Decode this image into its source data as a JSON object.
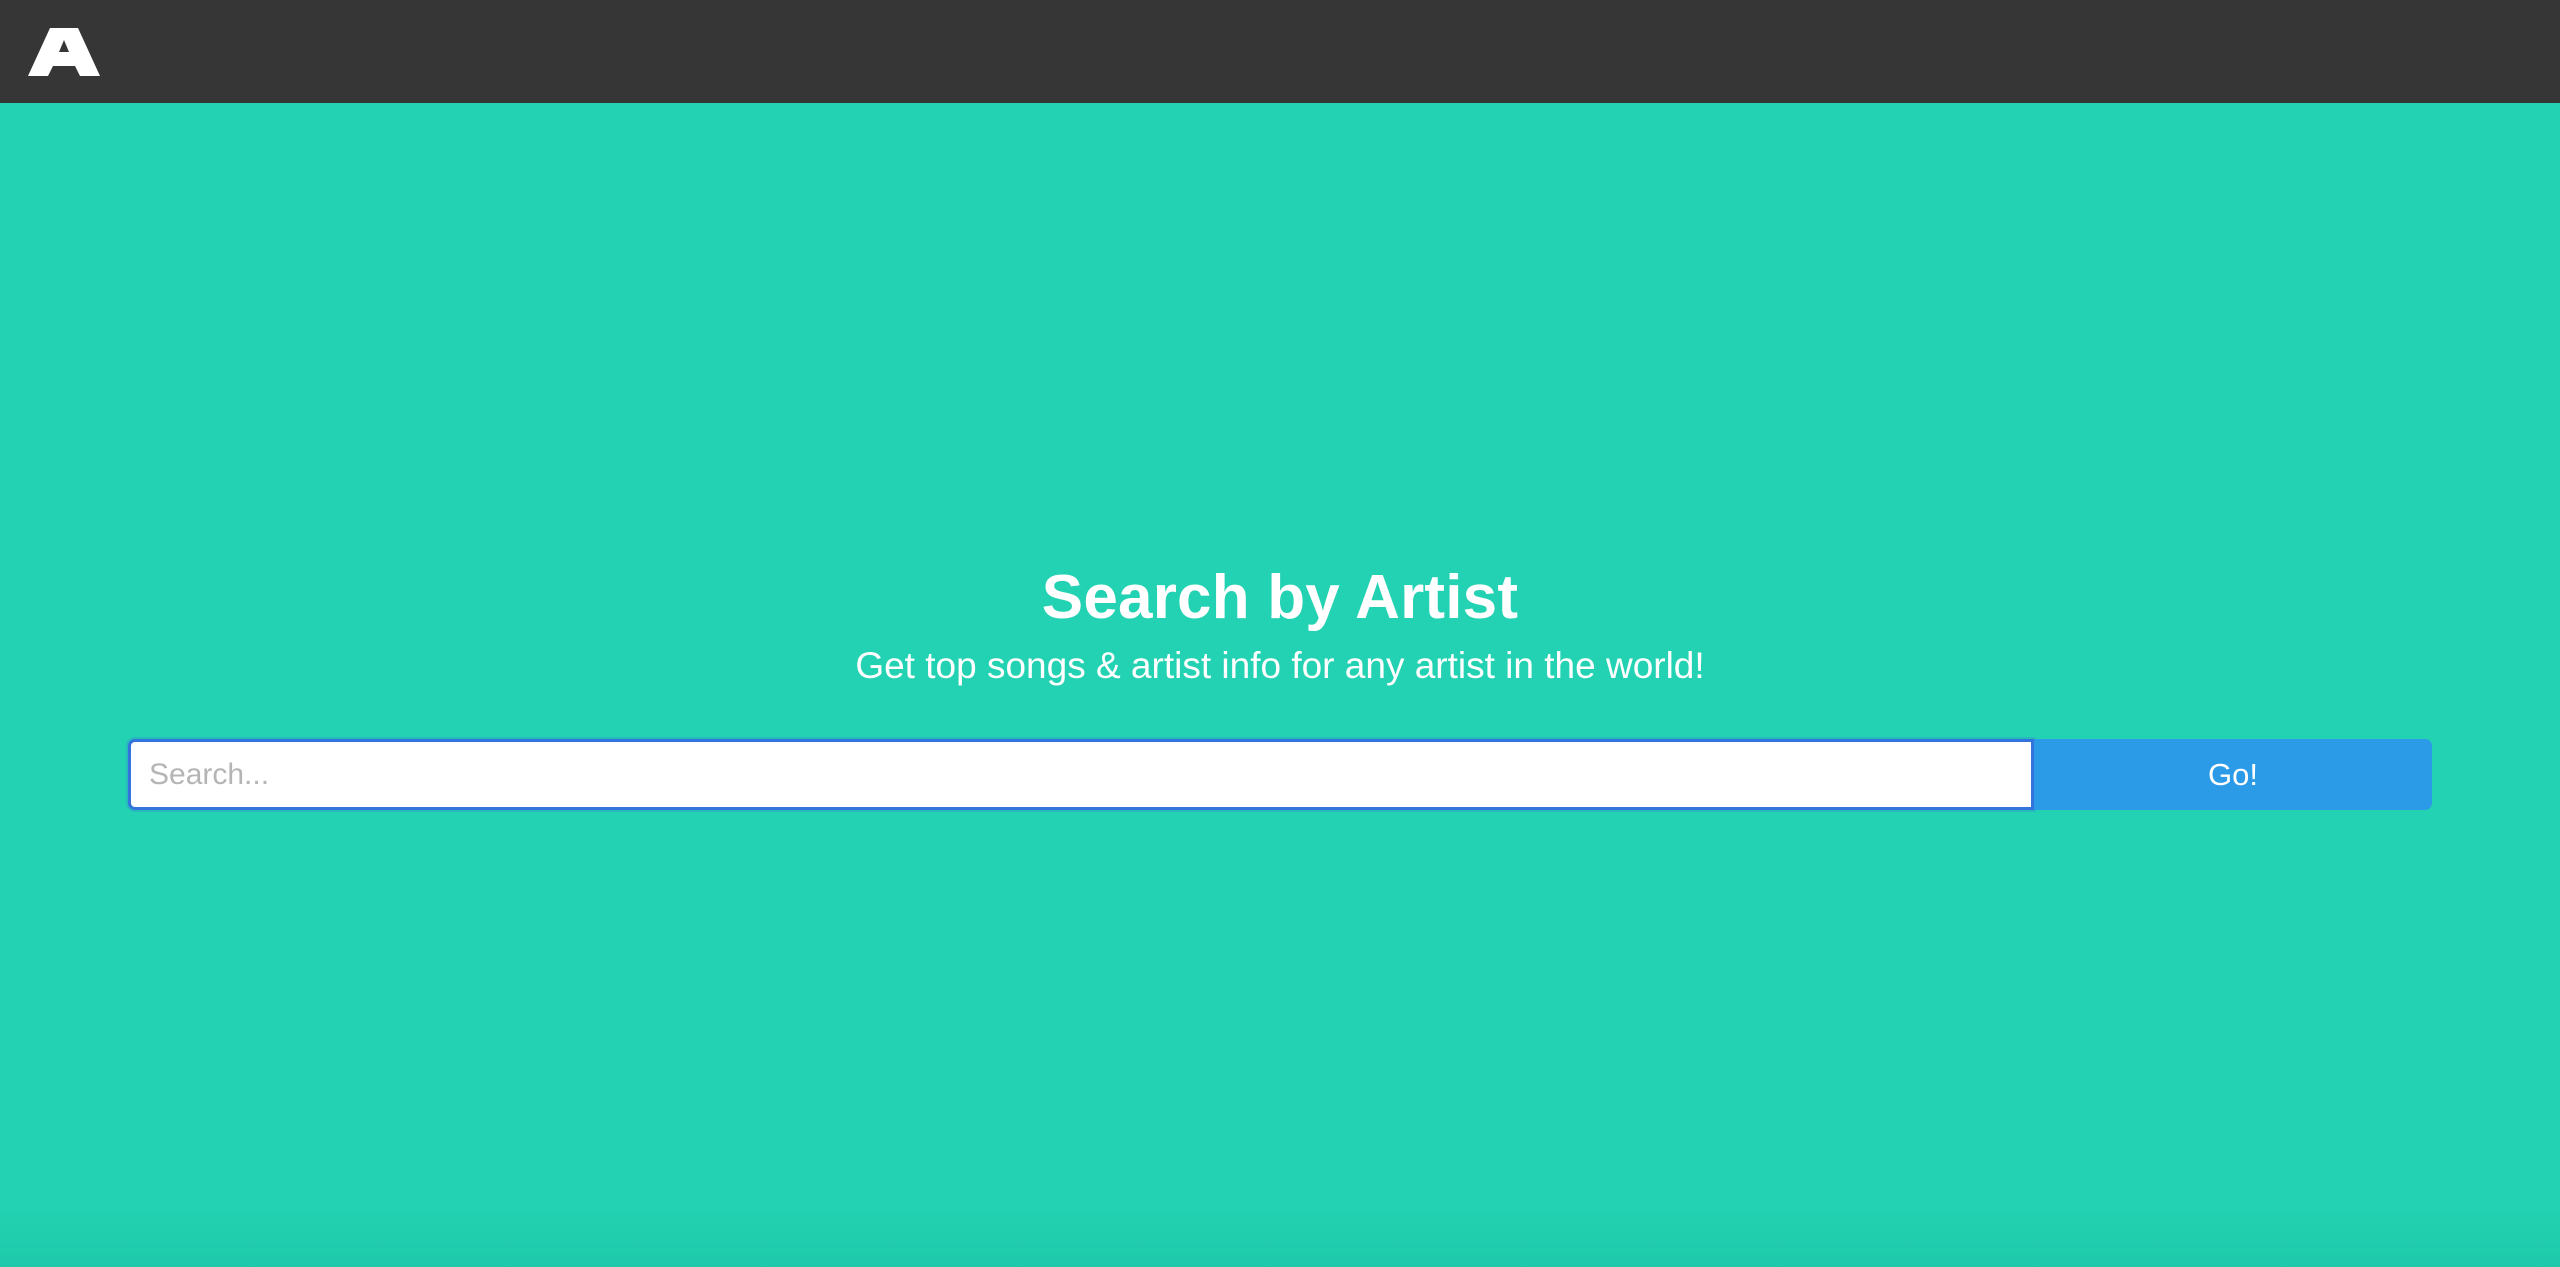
{
  "navbar": {
    "logo_icon": "triangle-a-logo-icon"
  },
  "hero": {
    "title": "Search by Artist",
    "subtitle": "Get top songs & artist info for any artist in the world!"
  },
  "search": {
    "value": "",
    "placeholder": "Search...",
    "button_label": "Go!"
  },
  "colors": {
    "navbar_bg": "#363636",
    "page_bg": "#23d2b2",
    "button_bg": "#2b9be8",
    "input_border": "#3273dc"
  }
}
